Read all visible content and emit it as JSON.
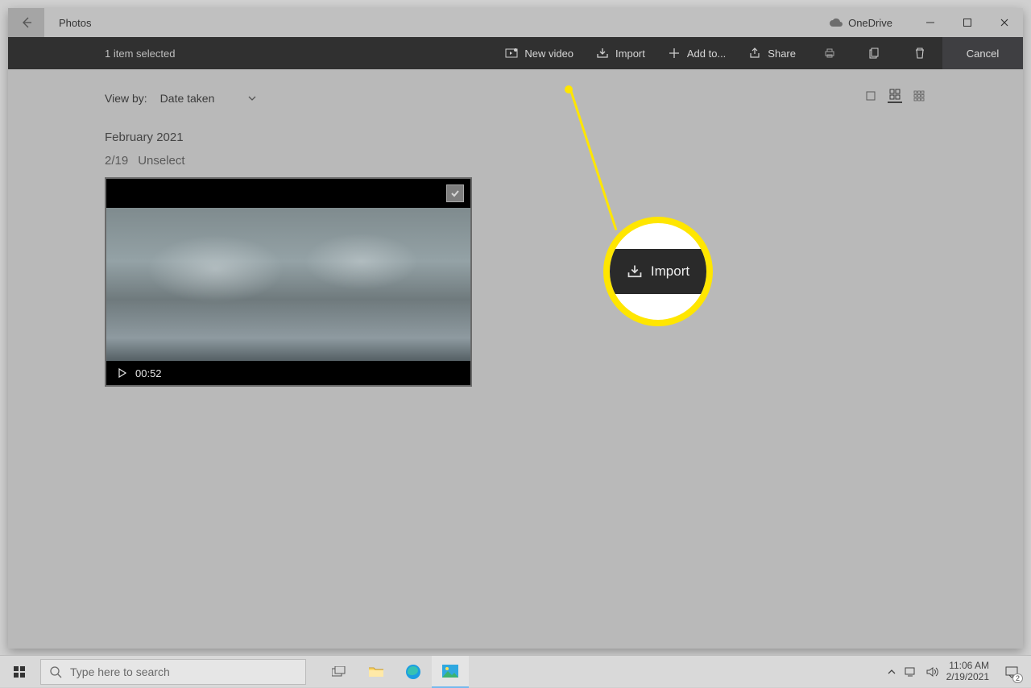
{
  "titlebar": {
    "app_title": "Photos",
    "onedrive_label": "OneDrive"
  },
  "toolbar": {
    "selected_count": "1 item selected",
    "new_video_label": "New video",
    "import_label": "Import",
    "add_to_label": "Add to...",
    "share_label": "Share",
    "cancel_label": "Cancel"
  },
  "content": {
    "view_by_label": "View by:",
    "view_by_value": "Date taken",
    "group_heading": "February 2021",
    "group_count": "2/19",
    "unselect_label": "Unselect",
    "video_duration": "00:52"
  },
  "callout": {
    "import_label": "Import"
  },
  "taskbar": {
    "search_placeholder": "Type here to search",
    "time": "11:06 AM",
    "date": "2/19/2021",
    "notif_count": "2"
  }
}
